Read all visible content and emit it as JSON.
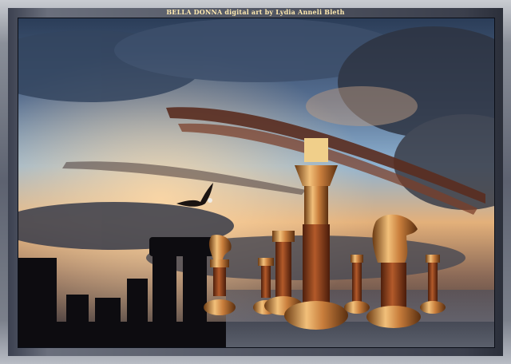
{
  "caption": "BELLA DONNA digital art by Lydia Anneli Bleth",
  "scene": {
    "subject": "chess-pieces-and-stonehenge",
    "colors": {
      "sky_top": "#2c3e58",
      "sky_blue": "#6f9fc7",
      "sunset": "#e9b27a",
      "bronze": "#c97e3c",
      "wood": "#8a3f1c",
      "frame": "#6a6f7c"
    }
  }
}
